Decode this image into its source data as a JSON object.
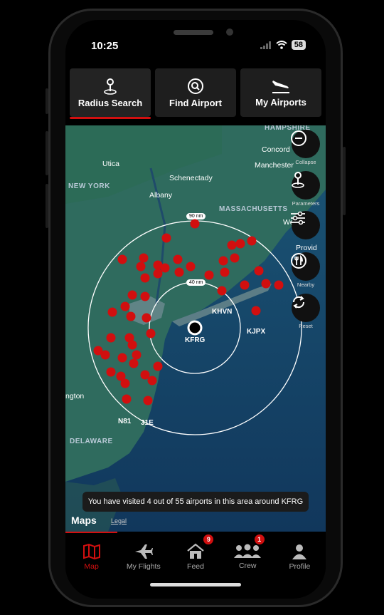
{
  "status": {
    "time": "10:25",
    "battery": "58"
  },
  "tabs": [
    {
      "label": "Radius Search",
      "icon": "pin-icon",
      "active": true
    },
    {
      "label": "Find Airport",
      "icon": "search-icon",
      "active": false
    },
    {
      "label": "My Airports",
      "icon": "plane-landing-icon",
      "active": false
    }
  ],
  "map": {
    "regions": [
      "HAMPSHIRE",
      "NEW YORK",
      "MASSACHUSETTS",
      "DELAWARE"
    ],
    "cities": [
      "Concord",
      "Utica",
      "Schenectady",
      "Manchester",
      "Albany",
      "Wo",
      "Provid",
      "ngton"
    ],
    "airports": [
      "KHVN",
      "KJPX",
      "KFRG",
      "N81",
      "31E"
    ],
    "ring_labels": [
      "90 nm",
      "40 nm"
    ],
    "controls": [
      "Collapse",
      "Parameters",
      "Filters",
      "Nearby",
      "Reset"
    ]
  },
  "toast": "You have visited 4 out of 55 airports in this area around KFRG",
  "attribution": {
    "logo": "Maps",
    "legal": "Legal"
  },
  "nav": [
    {
      "label": "Map",
      "icon": "map-icon",
      "active": true,
      "badge": ""
    },
    {
      "label": "My Flights",
      "icon": "airplane-icon",
      "active": false,
      "badge": ""
    },
    {
      "label": "Feed",
      "icon": "house-icon",
      "active": false,
      "badge": "9"
    },
    {
      "label": "Crew",
      "icon": "group-icon",
      "active": false,
      "badge": "1"
    },
    {
      "label": "Profile",
      "icon": "person-icon",
      "active": false,
      "badge": ""
    }
  ],
  "colors": {
    "accent": "#d10f0f",
    "land": "#2f6b5e",
    "water": "#143f63",
    "pin": "#d10f0f"
  }
}
